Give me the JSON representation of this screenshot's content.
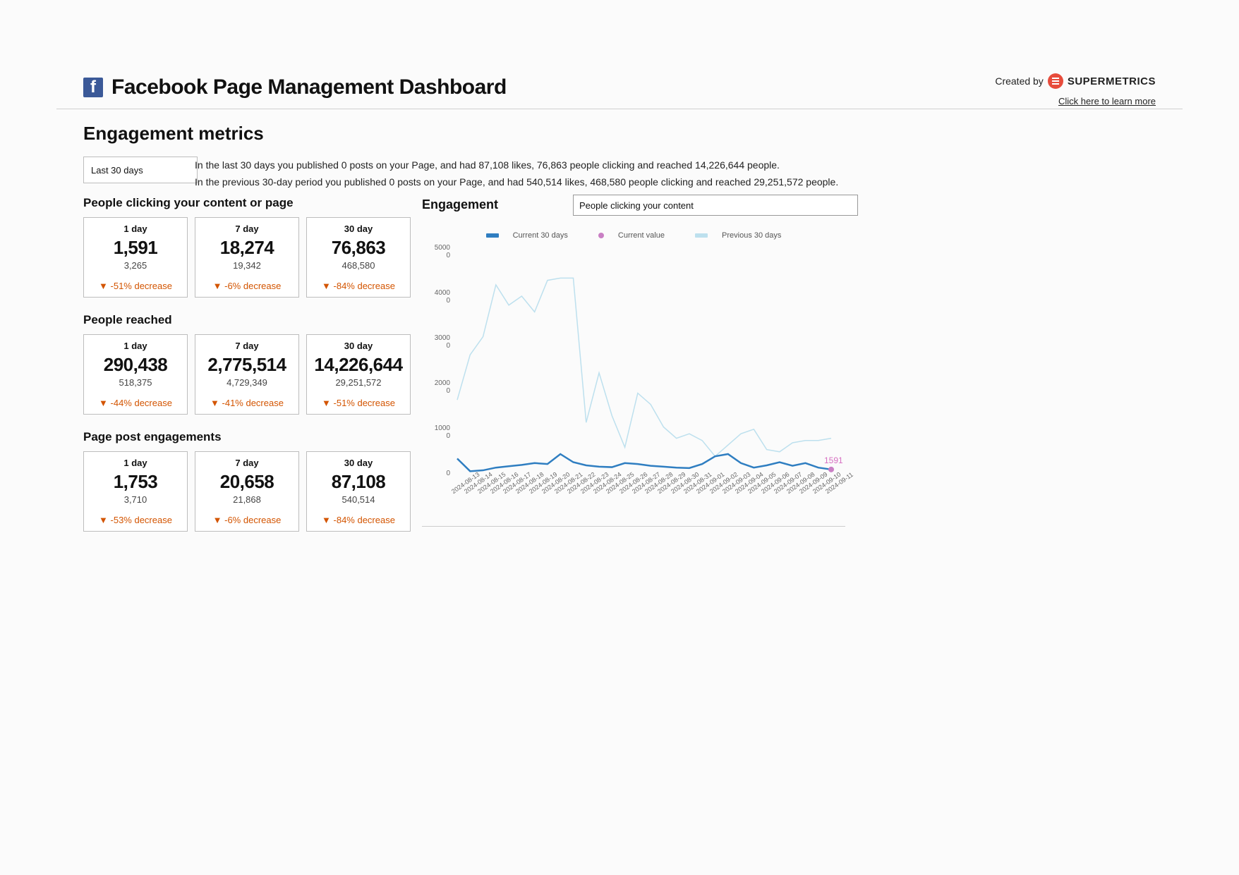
{
  "header": {
    "title": "Facebook Page Management Dashboard",
    "created_by": "Created by",
    "supermetrics": "SUPERMETRICS",
    "learn_more": "Click here to learn more"
  },
  "section": {
    "title": "Engagement metrics",
    "date_range": "Last 30 days",
    "summary_line1": "In the last 30 days you published 0 posts on your Page, and had 87,108 likes, 76,863 people clicking and reached 14,226,644 people.",
    "summary_line2": "In the previous 30-day period you published 0 posts on your Page, and had 540,514 likes, 468,580 people clicking and reached 29,251,572 people."
  },
  "groups": [
    {
      "title": "People clicking your content or page",
      "cards": [
        {
          "label": "1 day",
          "value": "1,591",
          "prev": "3,265",
          "delta": "-51% decrease"
        },
        {
          "label": "7 day",
          "value": "18,274",
          "prev": "19,342",
          "delta": "-6% decrease"
        },
        {
          "label": "30 day",
          "value": "76,863",
          "prev": "468,580",
          "delta": "-84% decrease"
        }
      ]
    },
    {
      "title": "People reached",
      "cards": [
        {
          "label": "1 day",
          "value": "290,438",
          "prev": "518,375",
          "delta": "-44% decrease"
        },
        {
          "label": "7 day",
          "value": "2,775,514",
          "prev": "4,729,349",
          "delta": "-41% decrease"
        },
        {
          "label": "30 day",
          "value": "14,226,644",
          "prev": "29,251,572",
          "delta": "-51% decrease"
        }
      ]
    },
    {
      "title": "Page post engagements",
      "cards": [
        {
          "label": "1 day",
          "value": "1,753",
          "prev": "3,710",
          "delta": "-53% decrease"
        },
        {
          "label": "7 day",
          "value": "20,658",
          "prev": "21,868",
          "delta": "-6% decrease"
        },
        {
          "label": "30 day",
          "value": "87,108",
          "prev": "540,514",
          "delta": "-84% decrease"
        }
      ]
    }
  ],
  "engagement_panel": {
    "title": "Engagement",
    "select_value": "People clicking your content",
    "legend": {
      "series1": "Current 30 days",
      "series2": "Current value",
      "series3": "Previous 30 days"
    },
    "point_label": "1591"
  },
  "chart_data": {
    "type": "line",
    "title": "Engagement — People clicking your content",
    "xlabel": "",
    "ylabel": "",
    "ylim": [
      0,
      50000
    ],
    "y_ticks": [
      0,
      10000,
      20000,
      30000,
      40000,
      50000
    ],
    "categories": [
      "2024-08-13",
      "2024-08-14",
      "2024-08-15",
      "2024-08-16",
      "2024-08-17",
      "2024-08-18",
      "2024-08-19",
      "2024-08-20",
      "2024-08-21",
      "2024-08-22",
      "2024-08-23",
      "2024-08-24",
      "2024-08-25",
      "2024-08-26",
      "2024-08-27",
      "2024-08-28",
      "2024-08-29",
      "2024-08-30",
      "2024-08-31",
      "2024-09-01",
      "2024-09-02",
      "2024-09-03",
      "2024-09-04",
      "2024-09-05",
      "2024-09-06",
      "2024-09-07",
      "2024-09-08",
      "2024-09-09",
      "2024-09-10",
      "2024-09-11"
    ],
    "series": [
      {
        "name": "Previous 30 days",
        "color": "#bde0ee",
        "values": [
          17000,
          27000,
          31000,
          42500,
          38000,
          40000,
          36500,
          43500,
          44000,
          44000,
          12000,
          23000,
          13500,
          6500,
          18500,
          16000,
          11000,
          8500,
          9500,
          8000,
          4500,
          7000,
          9500,
          10500,
          6000,
          5500,
          7500,
          8000,
          8000,
          8500
        ]
      },
      {
        "name": "Current 30 days",
        "color": "#2f7ec1",
        "values": [
          4000,
          1200,
          1400,
          2000,
          2300,
          2600,
          3000,
          2800,
          5000,
          3200,
          2500,
          2200,
          2100,
          3000,
          2800,
          2400,
          2200,
          2000,
          1900,
          2800,
          4500,
          5000,
          3000,
          2000,
          2500,
          3200,
          2400,
          3000,
          2000,
          1591
        ]
      },
      {
        "name": "Current value",
        "color": "#c97fc4",
        "type": "point",
        "x": "2024-09-11",
        "y": 1591
      }
    ]
  }
}
